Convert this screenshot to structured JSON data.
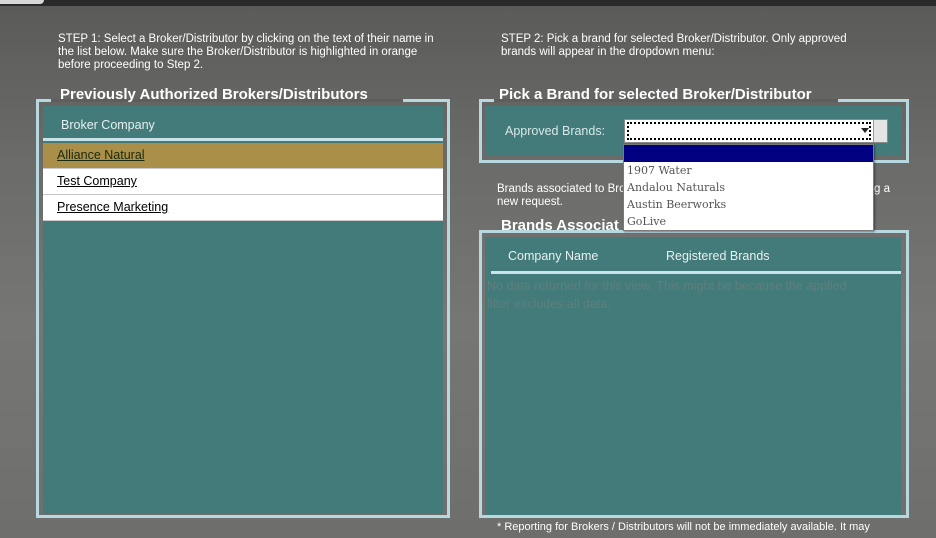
{
  "step1": {
    "text": "STEP 1: Select a Broker/Distributor by clicking on the text of their name in the list below. Make sure the Broker/Distributor is highlighted in orange before proceeding to Step 2."
  },
  "step2": {
    "text": "STEP 2: Pick a brand for selected Broker/Distributor. Only approved brands will appear in the dropdown menu:"
  },
  "left_panel": {
    "title": "Previously Authorized Brokers/Distributors",
    "column_header": "Broker Company",
    "items": [
      {
        "label": "Alliance Natural",
        "selected": true
      },
      {
        "label": "Test Company",
        "selected": false
      },
      {
        "label": "Presence Marketing",
        "selected": false
      }
    ]
  },
  "pick_panel": {
    "title": "Pick a Brand for selected Broker/Distributor",
    "approved_label": "Approved Brands:",
    "selected_value": "",
    "dropdown_options": [
      "",
      "1907 Water",
      "Andalou Naturals",
      "Austin Beerworks",
      "GoLive"
    ]
  },
  "brands_text": {
    "left": "Brands associated to Bro",
    "right": "g a",
    "line2": "new request."
  },
  "brands_panel": {
    "title": "Brands Associat",
    "col1": "Company Name",
    "col2": "Registered Brands",
    "nodata_line1": "No data returned for this view. This might be because the applied",
    "nodata_line2": "filter excludes all data."
  },
  "footnote": "* Reporting for Brokers / Distributors will not be immediately available. It may",
  "colors": {
    "teal": "#427b7a",
    "selected_row": "#a98f48",
    "frame_border": "#b8d8e0",
    "dropdown_highlight": "#000080"
  }
}
